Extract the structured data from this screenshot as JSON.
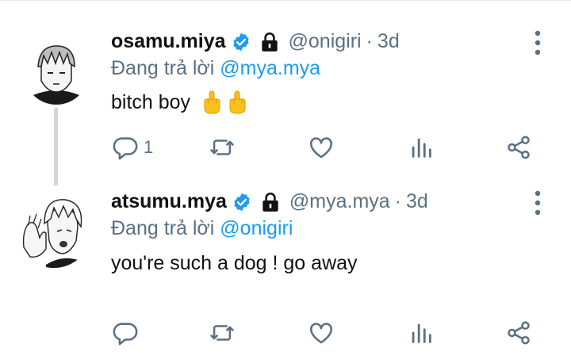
{
  "tweets": [
    {
      "display_name": "osamu.miya",
      "handle": "@onigiri",
      "separator": "·",
      "time": "3d",
      "reply_prefix": "Đang trả lời",
      "reply_to": "@mya.mya",
      "text": "bitch boy",
      "emoji": [
        "middle-finger-emoji",
        "middle-finger-emoji"
      ],
      "reply_count": "1"
    },
    {
      "display_name": "atsumu.mya",
      "handle": "@mya.mya",
      "separator": "·",
      "time": "3d",
      "reply_prefix": "Đang trả lời",
      "reply_to": "@onigiri",
      "text": "you're such a dog ! go away",
      "emoji": [],
      "reply_count": ""
    }
  ],
  "icons": {
    "verified": "verified-badge-icon",
    "lock": "lock-icon",
    "more": "more-vertical-icon",
    "reply": "reply-icon",
    "retweet": "retweet-icon",
    "like": "like-icon",
    "analytics": "analytics-icon",
    "share": "share-icon"
  },
  "colors": {
    "accent": "#1d9bf0",
    "secondary_text": "#5b7083",
    "thread_line": "#d0d5d8"
  }
}
